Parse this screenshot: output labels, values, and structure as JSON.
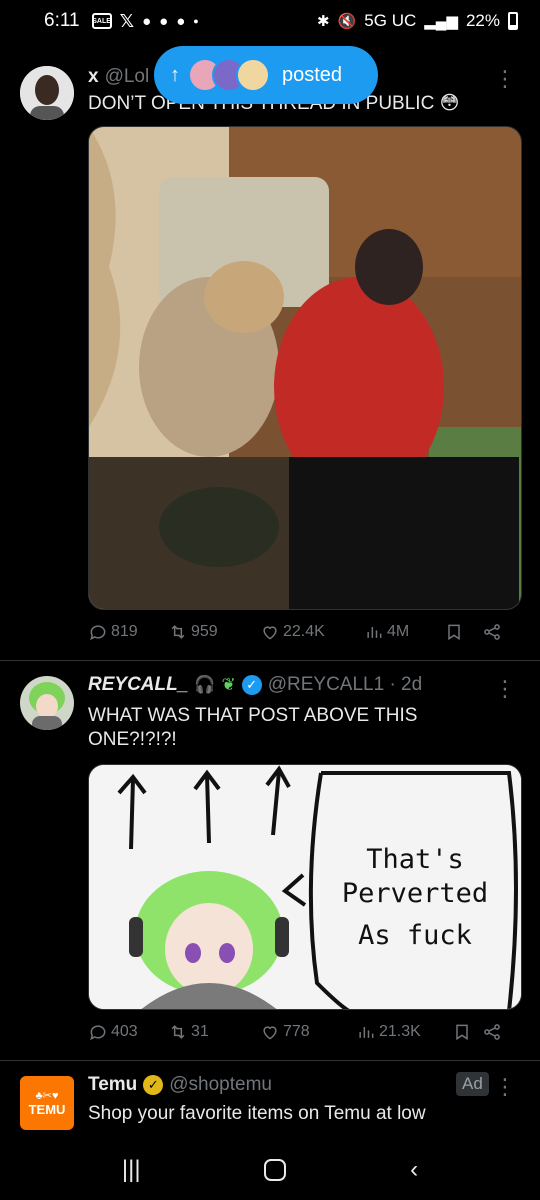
{
  "status_bar": {
    "time": "6:11",
    "network": "5G UC",
    "battery": "22%"
  },
  "posted_pill": {
    "label": "posted"
  },
  "tweets": [
    {
      "display_name": "x",
      "handle": "@Lol",
      "text": "DON’T OPEN THIS THREAD IN PUBLIC 😳",
      "replies": "819",
      "reposts": "959",
      "likes": "22.4K",
      "views": "4M"
    },
    {
      "display_name": "REYCALL_",
      "handle": "@REYCALL1 · 2d",
      "text": "WHAT WAS THAT POST ABOVE THIS ONE?!?!?!",
      "meme_text": [
        "That's",
        "Perverted",
        "As fuck"
      ],
      "replies": "403",
      "reposts": "31",
      "likes": "778",
      "views": "21.3K"
    }
  ],
  "ad": {
    "display_name": "Temu",
    "handle": "@shoptemu",
    "badge": "Ad",
    "text": "Shop your favorite items on Temu at low",
    "logo_text": "TEMU"
  },
  "colors": {
    "accent": "#1d9bf0",
    "muted": "#71767b",
    "temu": "#fb7701"
  }
}
